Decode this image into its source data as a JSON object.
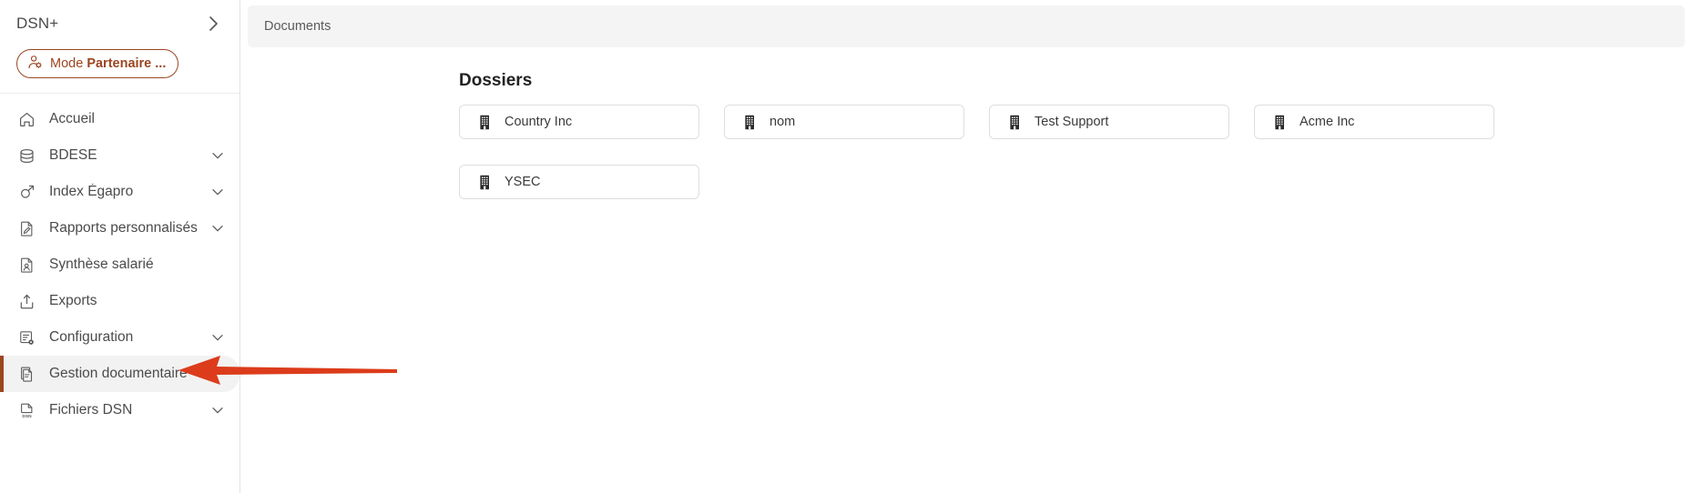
{
  "colors": {
    "accent": "#9c4620",
    "annotation_arrow": "#dc3c1b",
    "sidebar_active_bg": "#f2f2f2",
    "topbar_bg": "#f4f4f5",
    "card_border": "#dedede"
  },
  "sidebar": {
    "brand": "DSN+",
    "brand_chevron_icon": "chevron-right-icon",
    "partner_button": {
      "icon": "user-gear-icon",
      "label_normal": "Mode ",
      "label_bold": "Partenaire ..."
    },
    "items": [
      {
        "label": "Accueil",
        "icon": "home-icon",
        "has_chevron": false,
        "active": false
      },
      {
        "label": "BDESE",
        "icon": "database-icon",
        "has_chevron": true,
        "active": false
      },
      {
        "label": "Index Égapro",
        "icon": "gender-icon",
        "has_chevron": true,
        "active": false
      },
      {
        "label": "Rapports personnalisés",
        "icon": "file-pencil-icon",
        "has_chevron": true,
        "active": false
      },
      {
        "label": "Synthèse salarié",
        "icon": "file-user-icon",
        "has_chevron": false,
        "active": false
      },
      {
        "label": "Exports",
        "icon": "upload-box-icon",
        "has_chevron": false,
        "active": false
      },
      {
        "label": "Configuration",
        "icon": "list-gear-icon",
        "has_chevron": true,
        "active": false
      },
      {
        "label": "Gestion documentaire",
        "icon": "documents-icon",
        "has_chevron": false,
        "active": true
      },
      {
        "label": "Fichiers DSN",
        "icon": "dsn-file-icon",
        "has_chevron": true,
        "active": false
      }
    ]
  },
  "main": {
    "topbar": {
      "tab_label": "Documents"
    },
    "section": {
      "title": "Dossiers",
      "folders": [
        {
          "label": "Country Inc",
          "icon": "building-icon"
        },
        {
          "label": "nom",
          "icon": "building-icon"
        },
        {
          "label": "Test Support",
          "icon": "building-icon"
        },
        {
          "label": "Acme Inc",
          "icon": "building-icon"
        },
        {
          "label": "YSEC",
          "icon": "building-icon"
        }
      ]
    }
  },
  "annotation": {
    "type": "arrow",
    "direction": "left",
    "points_to": "Gestion documentaire"
  }
}
